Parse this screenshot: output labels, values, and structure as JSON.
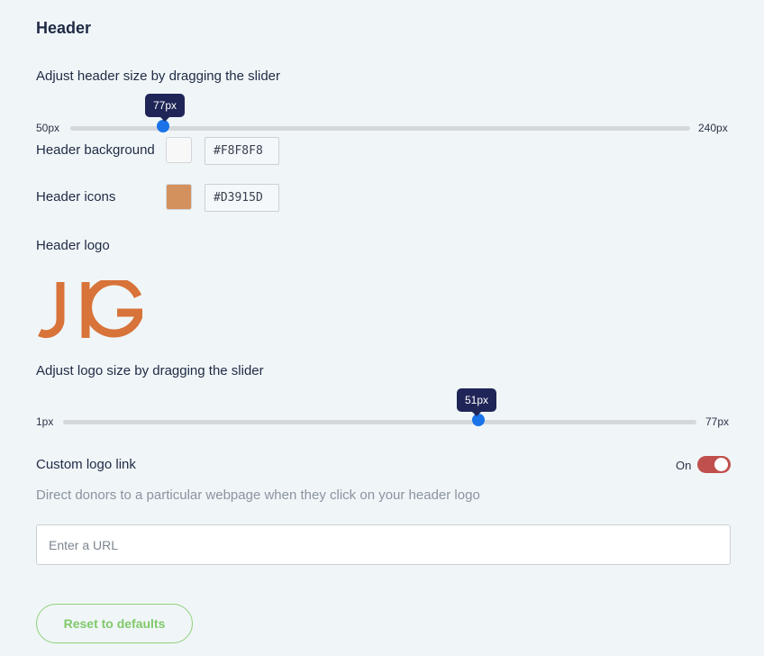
{
  "section_title": "Header",
  "header_size": {
    "label": "Adjust header size by dragging the slider",
    "min_label": "50px",
    "max_label": "240px",
    "value_label": "77px",
    "min": 50,
    "max": 240,
    "value": 77
  },
  "header_background": {
    "label": "Header background",
    "color": "#F8F8F8",
    "hex_text": "#F8F8F8"
  },
  "header_icons": {
    "label": "Header icons",
    "color": "#D3915D",
    "hex_text": "#D3915D"
  },
  "header_logo": {
    "label": "Header logo",
    "logo_text": "JIG",
    "logo_color": "#D8733A"
  },
  "logo_size": {
    "label": "Adjust logo size by dragging the slider",
    "min_label": "1px",
    "max_label": "77px",
    "value_label": "51px",
    "min": 1,
    "max": 77,
    "value": 51
  },
  "custom_logo_link": {
    "label": "Custom logo link",
    "toggle_label": "On",
    "enabled": true,
    "hint": "Direct donors to a particular webpage when they click on your header logo",
    "url_placeholder": "Enter a URL",
    "url_value": ""
  },
  "reset_button": "Reset to defaults"
}
